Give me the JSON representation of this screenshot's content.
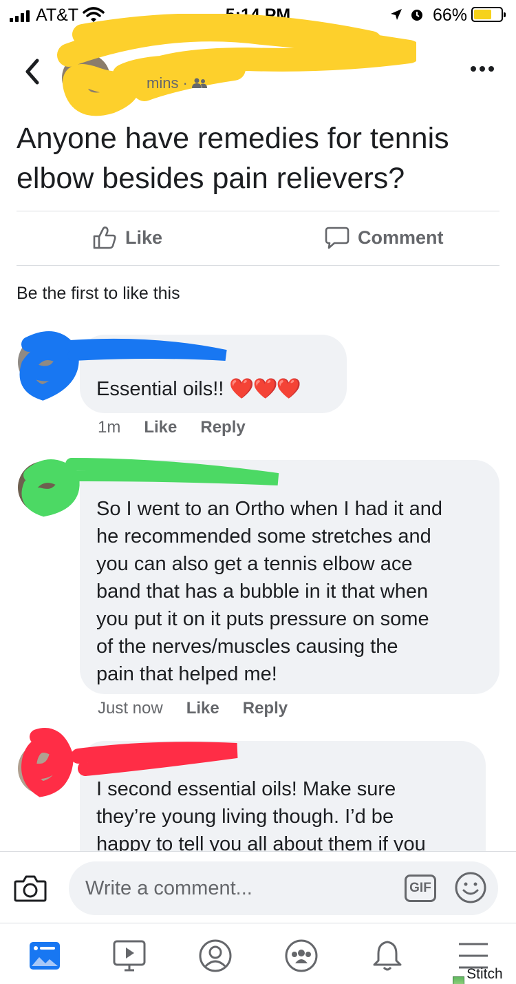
{
  "status_bar": {
    "carrier": "AT&T",
    "time": "5:14 PM",
    "battery_percent": "66%",
    "battery_level": 0.66
  },
  "header": {
    "meta_time": "mins",
    "meta_separator": "·"
  },
  "post": {
    "text": "Anyone have remedies for tennis elbow besides pain relievers?",
    "like_label": "Like",
    "comment_label": "Comment",
    "reactions_summary": "Be the first to like this"
  },
  "comments": [
    {
      "text": "Essential oils!!",
      "emoji": "❤️❤️❤️",
      "time": "1m",
      "like_label": "Like",
      "reply_label": "Reply",
      "scribble_color": "#1877f2"
    },
    {
      "lines": [
        "So I went to an Ortho when I had it and",
        "he recommended some stretches and",
        "you can also get a tennis elbow ace",
        "band that has a bubble in it that when",
        "you put it on it puts pressure on some",
        "of the nerves/muscles causing the",
        "pain that helped me!"
      ],
      "time": "Just now",
      "like_label": "Like",
      "reply_label": "Reply",
      "scribble_color": "#4cd964"
    },
    {
      "lines": [
        "I second essential oils! Make sure",
        "they’re young living though. I’d be",
        "happy to tell you all about them if you"
      ],
      "scribble_color": "#ff2d46"
    }
  ],
  "composer": {
    "placeholder": "Write a comment...",
    "gif_label": "GIF"
  },
  "tab_bar": {
    "tabs": [
      "news-feed",
      "watch",
      "profile",
      "groups",
      "notifications",
      "menu"
    ]
  },
  "watermark": "Stitch It!",
  "colors": {
    "bubble": "#f0f2f5",
    "secondary_text": "#65676b",
    "feed_blue": "#1877f2",
    "scribble_yellow": "#fdd02c"
  }
}
